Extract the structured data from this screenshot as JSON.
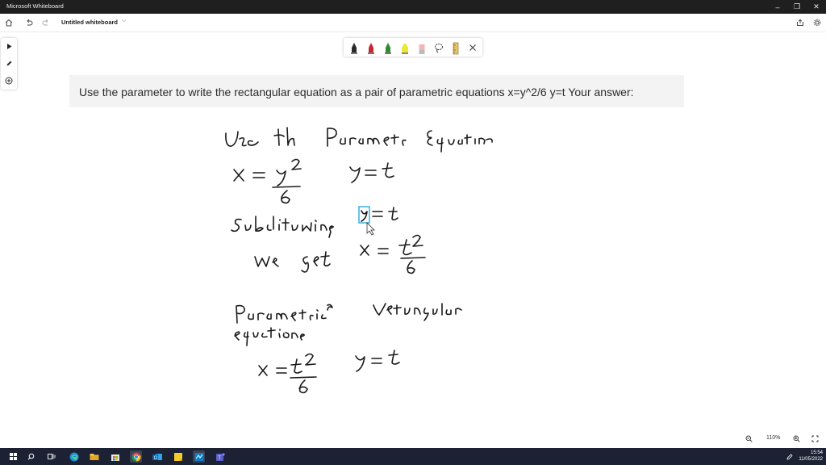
{
  "window": {
    "title": "Microsoft Whiteboard"
  },
  "toolbar": {
    "doc_title": "Untitled whiteboard"
  },
  "prompt": {
    "text": "Use the parameter to write the rectangular equation as a pair of parametric equations x=y^2/6 y=t Your answer:"
  },
  "zoom": {
    "level": "110%"
  },
  "taskbar": {
    "time": "15:54",
    "date": "11/05/2022"
  },
  "colors": {
    "titlebar": "#1f1f1f",
    "taskbar": "#1c2233",
    "selection": "#1aa3d9"
  },
  "icons": [
    "home-icon",
    "undo-icon",
    "redo-icon",
    "share-icon",
    "settings-icon",
    "select-icon",
    "pen-icon",
    "add-icon",
    "lasso-icon",
    "ruler-icon",
    "close-icon",
    "zoom-out-icon",
    "zoom-in-icon"
  ]
}
